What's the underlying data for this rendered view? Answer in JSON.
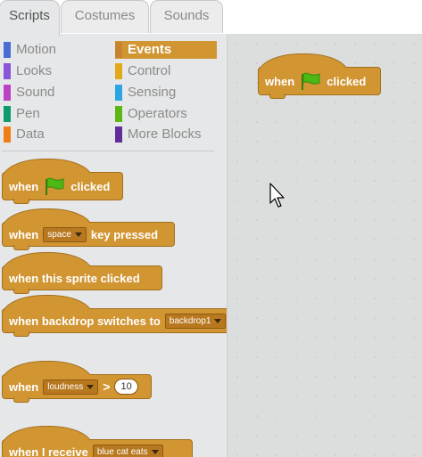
{
  "tabs": [
    "Scripts",
    "Costumes",
    "Sounds"
  ],
  "active_tab": "Scripts",
  "categories": [
    {
      "label": "Motion",
      "color": "#4a6cd4"
    },
    {
      "label": "Looks",
      "color": "#8a55d7"
    },
    {
      "label": "Sound",
      "color": "#bb42c3"
    },
    {
      "label": "Pen",
      "color": "#0e9a6c"
    },
    {
      "label": "Data",
      "color": "#ee7d16"
    },
    {
      "label": "Events",
      "color": "#c88330"
    },
    {
      "label": "Control",
      "color": "#e1a91a"
    },
    {
      "label": "Sensing",
      "color": "#2ca5e2"
    },
    {
      "label": "Operators",
      "color": "#5cb712"
    },
    {
      "label": "More Blocks",
      "color": "#632d99"
    }
  ],
  "selected_category": "Events",
  "palette_blocks": {
    "flag": {
      "when": "when",
      "clicked": "clicked"
    },
    "key": {
      "when": "when",
      "key_value": "space",
      "key_pressed": "key pressed"
    },
    "sprite": {
      "text": "when this sprite clicked"
    },
    "backdrop": {
      "text": "when backdrop switches to",
      "value": "backdrop1"
    },
    "loudness": {
      "when": "when",
      "sensor": "loudness",
      "op": ">",
      "value": "10"
    },
    "receive": {
      "text": "when I receive",
      "value": "blue cat eats"
    }
  },
  "script_blocks": {
    "flag": {
      "when": "when",
      "clicked": "clicked"
    }
  }
}
